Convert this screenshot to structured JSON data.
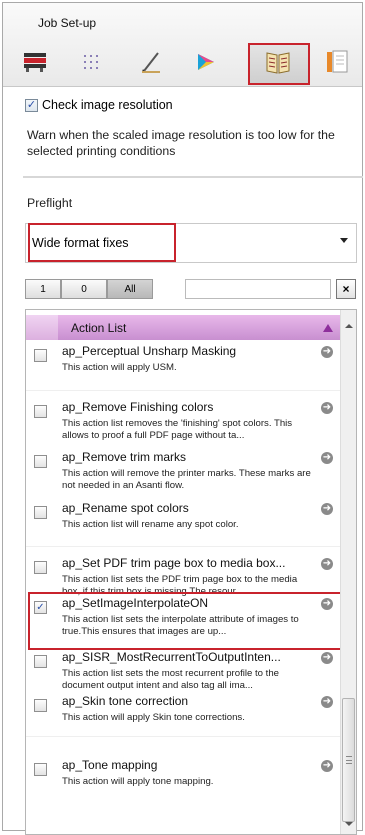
{
  "panel": {
    "title": "Job Set-up",
    "toolbar": [
      {
        "name": "color-bars-icon"
      },
      {
        "name": "grid-icon"
      },
      {
        "name": "pen-icon"
      },
      {
        "name": "color-wheel-icon"
      },
      {
        "name": "book-icon",
        "selected": true
      },
      {
        "name": "document-icon"
      }
    ]
  },
  "resolution": {
    "checkbox_label": "Check image resolution",
    "checked": true,
    "warning": "Warn when the scaled image resolution is too low for the selected printing conditions"
  },
  "preflight": {
    "label": "Preflight",
    "selected": "Wide format fixes"
  },
  "filter": {
    "buttons": [
      "1",
      "0",
      "All"
    ],
    "active": "All",
    "search_value": "",
    "clear_icon": "×"
  },
  "action_list": {
    "header": "Action List",
    "rows": [
      {
        "name": "ap_Perceptual Unsharp Masking",
        "desc": "This action will apply USM.",
        "checked": false
      },
      {
        "name": "ap_Remove Finishing colors",
        "desc": "This action list removes the 'finishing' spot colors. This allows to proof a full PDF page without ta...",
        "checked": false
      },
      {
        "name": "ap_Remove trim marks",
        "desc": "This action will remove the printer marks. These marks are not needed in an Asanti flow.",
        "checked": false
      },
      {
        "name": "ap_Rename spot colors",
        "desc": "This action list will rename any spot color.",
        "checked": false
      },
      {
        "name": "ap_Set PDF trim page box to media box...",
        "desc": "This action list sets the PDF trim page box to the media box, if this trim box is missing.The resour...",
        "checked": false
      },
      {
        "name": "ap_SetImageInterpolateON",
        "desc": "This action list sets the interpolate attribute of images to true.This ensures that images are up...",
        "checked": true
      },
      {
        "name": "ap_SISR_MostRecurrentToOutputInten...",
        "desc": "This action list sets the most recurrent profile to the document output intent and also tag all ima...",
        "checked": false
      },
      {
        "name": "ap_Skin tone correction",
        "desc": "This action will apply Skin tone corrections.",
        "checked": false
      },
      {
        "name": "ap_Tone mapping",
        "desc": "This action will apply tone mapping.",
        "checked": false
      }
    ]
  },
  "colors": {
    "highlight": "#c8232c",
    "list_header": "#d29ad8",
    "check": "#2a4fa8"
  }
}
